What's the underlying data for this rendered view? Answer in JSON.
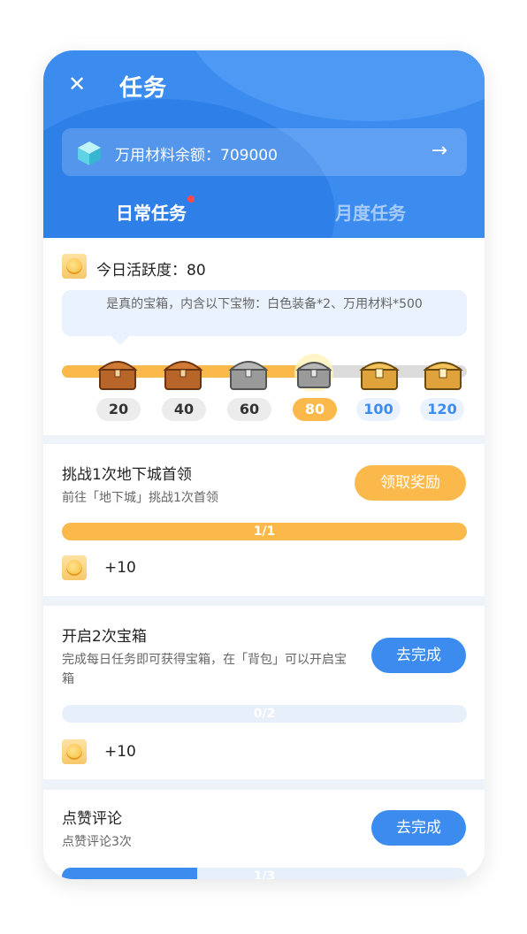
{
  "header": {
    "title": "任务",
    "close_icon": "close-icon",
    "balance_label": "万用材料余额：709000",
    "balance_icon": "cube-icon",
    "arrow_icon": "arrow-right-icon",
    "tabs": [
      {
        "label": "日常任务",
        "active": true,
        "has_dot": true
      },
      {
        "label": "月度任务",
        "active": false
      }
    ]
  },
  "activity": {
    "label": "今日活跃度：80",
    "value": 80,
    "tooltip": "是真的宝箱，内含以下宝物：白色装备*2、万用材料*500",
    "milestones": [
      {
        "value": "20",
        "state": "done",
        "chest": "brown"
      },
      {
        "value": "40",
        "state": "done",
        "chest": "brown"
      },
      {
        "value": "60",
        "state": "done",
        "chest": "silver"
      },
      {
        "value": "80",
        "state": "current",
        "chest": "silver"
      },
      {
        "value": "100",
        "state": "todo",
        "chest": "gold"
      },
      {
        "value": "120",
        "state": "todo",
        "chest": "gold"
      }
    ],
    "progress_fraction": 0.6
  },
  "tasks": [
    {
      "title": "挑战1次地下城首领",
      "desc": "前往「地下城」挑战1次首领",
      "button": "领取奖励",
      "progress_text": "1/1",
      "progress_fraction": 1.0,
      "reward": "+10"
    },
    {
      "title": "开启2次宝箱",
      "desc": "完成每日任务即可获得宝箱，在「背包」可以开启宝箱",
      "button": "去完成",
      "progress_text": "0/2",
      "progress_fraction": 0.0,
      "reward": "+10"
    },
    {
      "title": "点赞评论",
      "desc": "点赞评论3次",
      "button": "去完成",
      "progress_text": "1/3",
      "progress_fraction": 0.333
    }
  ],
  "colors": {
    "primary": "#3c8cf0",
    "gold": "#fbb94c",
    "bg": "#eef3fa"
  }
}
